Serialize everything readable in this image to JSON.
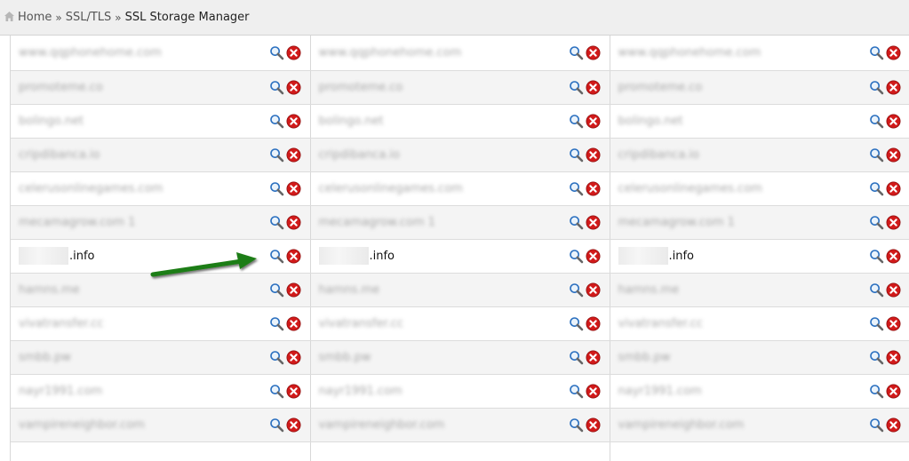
{
  "breadcrumb": {
    "home": "Home",
    "sep": "»",
    "section": "SSL/TLS",
    "current": "SSL Storage Manager"
  },
  "colors": {
    "accent_arrow": "#1e7d12",
    "delete_red": "#d11a1a",
    "magnifier_blue": "#2a6fbf"
  },
  "icons": {
    "view": "magnifier-icon",
    "delete": "delete-icon",
    "home": "home-icon"
  },
  "rows": [
    {
      "domains": [
        "www.qqphonehome.com",
        "www.qqphonehome.com",
        "www.qqphonehome.com"
      ],
      "blurred": true
    },
    {
      "domains": [
        "promoteme.co",
        "promoteme.co",
        "promoteme.co"
      ],
      "blurred": true
    },
    {
      "domains": [
        "bolingo.net",
        "bolingo.net",
        "bolingo.net"
      ],
      "blurred": true
    },
    {
      "domains": [
        "cripdibanca.io",
        "cripdibanca.io",
        "cripdibanca.io"
      ],
      "blurred": true
    },
    {
      "domains": [
        "celerusonlinegames.com",
        "celerusonlinegames.com",
        "celerusonlinegames.com"
      ],
      "blurred": true
    },
    {
      "domains": [
        "mecamagrow.com 1",
        "mecamagrow.com 1",
        "mecamagrow.com 1"
      ],
      "blurred": true
    },
    {
      "domains": [
        ".info",
        ".info",
        ".info"
      ],
      "blurred": false
    },
    {
      "domains": [
        "hamns.me",
        "hamns.me",
        "hamns.me"
      ],
      "blurred": true
    },
    {
      "domains": [
        "vivatransfer.cc",
        "vivatransfer.cc",
        "vivatransfer.cc"
      ],
      "blurred": true
    },
    {
      "domains": [
        "smbb.pw",
        "smbb.pw",
        "smbb.pw"
      ],
      "blurred": true
    },
    {
      "domains": [
        "nayr1991.com",
        "nayr1991.com",
        "nayr1991.com"
      ],
      "blurred": true
    },
    {
      "domains": [
        "vampireneighbor.com",
        "vampireneighbor.com",
        "vampireneighbor.com"
      ],
      "blurred": true
    },
    {
      "domains": [
        "",
        "",
        ""
      ],
      "blurred": true
    }
  ]
}
